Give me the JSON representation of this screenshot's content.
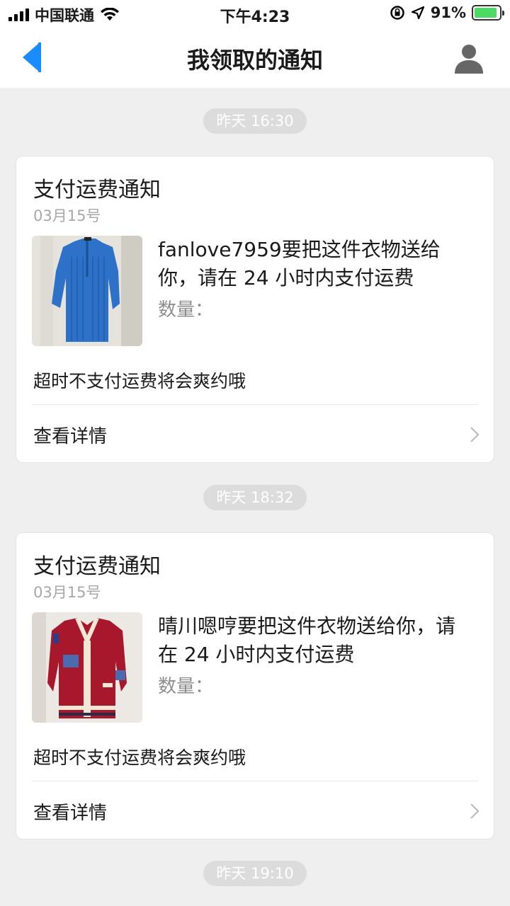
{
  "status": {
    "carrier": "中国联通",
    "time": "下午4:23",
    "battery": "91%",
    "battery_level": 0.91
  },
  "nav": {
    "title": "我领取的通知",
    "back_icon": "back-arrow-icon",
    "user_icon": "user-profile-icon"
  },
  "colors": {
    "accent": "#1a8cff",
    "background": "#efefef",
    "pill": "#dcdcdc",
    "muted": "#a7a7a7"
  },
  "notifications": [
    {
      "time": "昨天 16:30",
      "title": "支付运费通知",
      "date": "03月15号",
      "message": "fanlove7959要把这件衣物送给你，请在 24 小时内支付运费",
      "quantity_label": "数量：",
      "warning": "超时不支付运费将会爽约哦",
      "link_label": "查看详情",
      "thumb": "blue-knit-dress-image"
    },
    {
      "time": "昨天 18:32",
      "title": "支付运费通知",
      "date": "03月15号",
      "message": "晴川嗯哼要把这件衣物送给你，请在 24 小时内支付运费",
      "quantity_label": "数量：",
      "warning": "超时不支付运费将会爽约哦",
      "link_label": "查看详情",
      "thumb": "red-cardigan-image"
    },
    {
      "time": "昨天 19:10"
    }
  ]
}
